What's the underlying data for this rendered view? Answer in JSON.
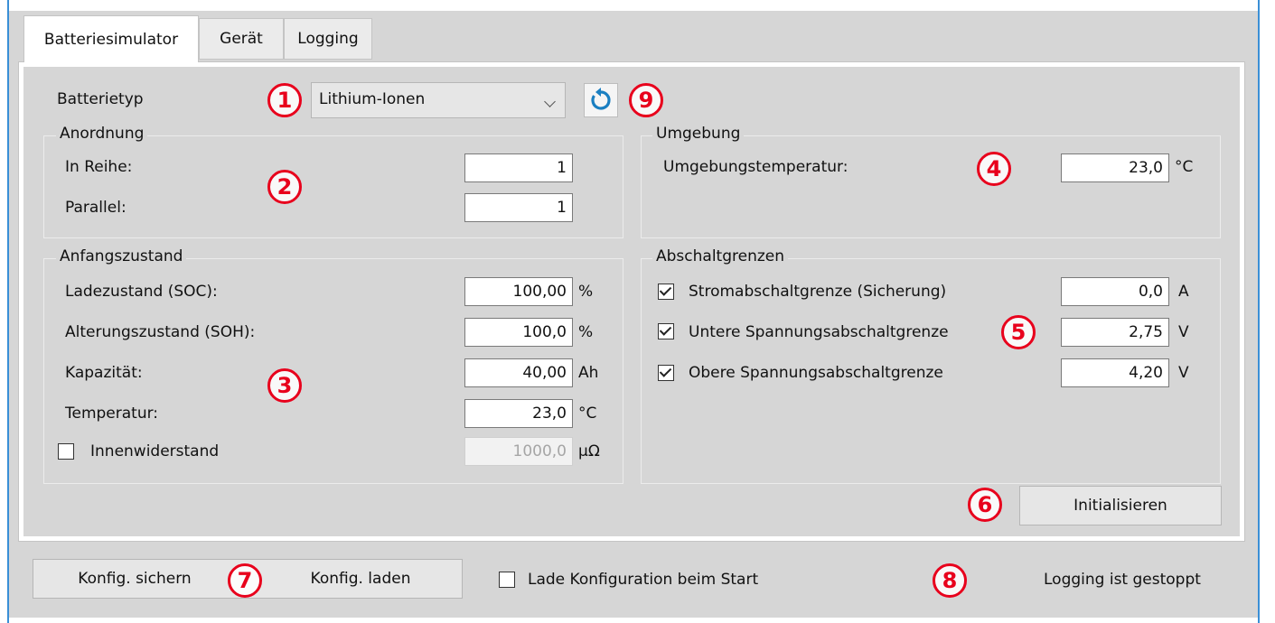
{
  "tabs": [
    "Batteriesimulator",
    "Gerät",
    "Logging"
  ],
  "battery_type": {
    "label": "Batterietyp",
    "value": "Lithium-Ionen"
  },
  "badges": [
    "1",
    "2",
    "3",
    "4",
    "5",
    "6",
    "7",
    "8",
    "9"
  ],
  "arrangement": {
    "title": "Anordnung",
    "in_series": {
      "label": "In Reihe:",
      "value": "1"
    },
    "parallel": {
      "label": "Parallel:",
      "value": "1"
    }
  },
  "environment": {
    "title": "Umgebung",
    "ambient_temp": {
      "label": "Umgebungstemperatur:",
      "value": "23,0",
      "unit": "°C"
    }
  },
  "initial_state": {
    "title": "Anfangszustand",
    "soc": {
      "label": "Ladezustand (SOC):",
      "value": "100,00",
      "unit": "%"
    },
    "soh": {
      "label": "Alterungszustand (SOH):",
      "value": "100,0",
      "unit": "%"
    },
    "capacity": {
      "label": "Kapazität:",
      "value": "40,00",
      "unit": "Ah"
    },
    "temperature": {
      "label": "Temperatur:",
      "value": "23,0",
      "unit": "°C"
    },
    "internal_resistance": {
      "label": "Innenwiderstand",
      "value": "1000,0",
      "unit": "µΩ",
      "checked": false
    }
  },
  "cutoff_limits": {
    "title": "Abschaltgrenzen",
    "current": {
      "label": "Stromabschaltgrenze (Sicherung)",
      "value": "0,0",
      "unit": "A",
      "checked": true
    },
    "lower_voltage": {
      "label": "Untere Spannungsabschaltgrenze",
      "value": "2,75",
      "unit": "V",
      "checked": true
    },
    "upper_voltage": {
      "label": "Obere Spannungsabschaltgrenze",
      "value": "4,20",
      "unit": "V",
      "checked": true
    }
  },
  "buttons": {
    "initialize": "Initialisieren",
    "save_config": "Konfig. sichern",
    "load_config": "Konfig. laden"
  },
  "load_on_start": {
    "label": "Lade Konfiguration beim Start",
    "checked": false
  },
  "status_text": "Logging ist gestoppt",
  "colors": {
    "badge": "#e8001c",
    "refresh_icon": "#1a7fc1",
    "window_edge": "#3a8fd6"
  }
}
